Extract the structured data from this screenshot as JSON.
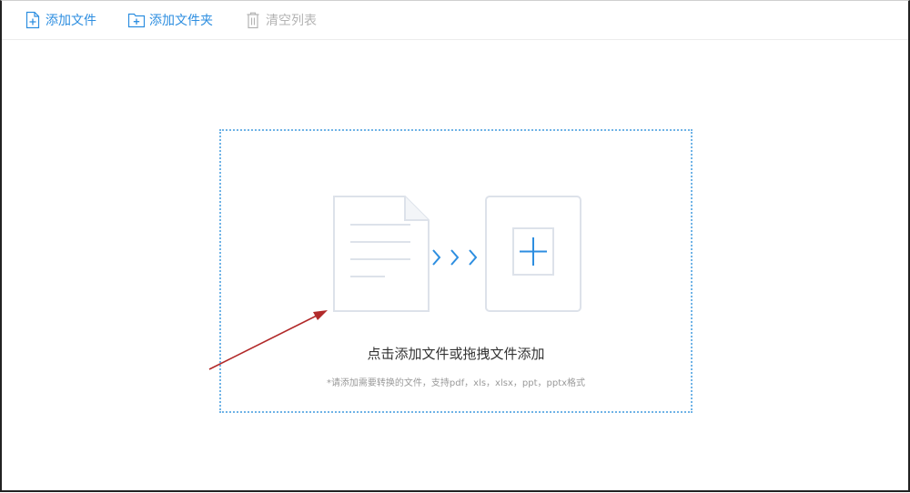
{
  "toolbar": {
    "add_file_label": "添加文件",
    "add_folder_label": "添加文件夹",
    "clear_list_label": "清空列表"
  },
  "drop_zone": {
    "title": "点击添加文件或拖拽文件添加",
    "hint": "*请添加需要转换的文件，支持pdf，xls，xlsx，ppt，pptx格式"
  },
  "icons": {
    "add_file": "file-plus-icon",
    "add_folder": "folder-plus-icon",
    "clear_list": "trash-icon",
    "document": "document-icon",
    "arrows": "chevrons-right-icon",
    "plus": "plus-icon",
    "annotation": "red-arrow-annotation"
  },
  "colors": {
    "accent": "#2d8ee0",
    "disabled": "#b3b3b3",
    "illustration_line": "#dde2ea",
    "drop_border": "#6fb3e6",
    "annotation": "#b22a2a"
  }
}
